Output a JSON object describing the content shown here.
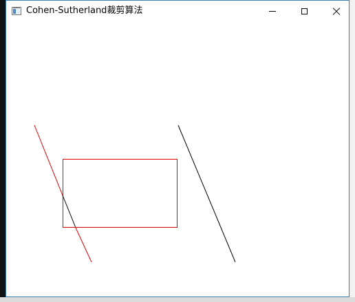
{
  "window": {
    "title": "Cohen-Sutherland裁剪算法",
    "app_icon": "window-app-icon",
    "controls": {
      "minimize_icon": "minimize-icon",
      "maximize_icon": "maximize-icon",
      "close_icon": "close-icon"
    }
  },
  "colors": {
    "clip_window": "#e00000",
    "line_outside_part": "#e00000",
    "line_inside_part": "#000000",
    "line_unclipped": "#000000",
    "title_bar": "#ffffff",
    "frame_border": "#3c7fb1"
  }
}
